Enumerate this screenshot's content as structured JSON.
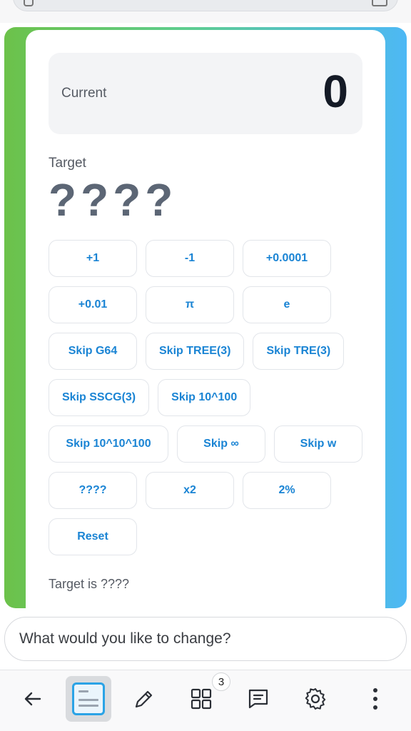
{
  "current": {
    "label": "Current",
    "value": "0"
  },
  "target": {
    "label": "Target",
    "value": "????"
  },
  "buttons": {
    "row1": [
      "+1",
      "-1",
      "+0.0001"
    ],
    "row2": [
      "+0.01",
      "π",
      "e"
    ],
    "row3": [
      "Skip G64",
      "Skip TREE(3)",
      "Skip TRE(3)"
    ],
    "row4": [
      "Skip SSCG(3)",
      "Skip 10^100"
    ],
    "row5": [
      "Skip 10^10^100",
      "Skip ∞",
      "Skip w"
    ],
    "row6": [
      "????",
      "x2",
      "2%"
    ],
    "row7": [
      "Reset"
    ]
  },
  "status": "Target is ????",
  "chat": {
    "placeholder": "What would you like to change?"
  },
  "toolbar": {
    "items": [
      "back-icon",
      "page-thumbnail",
      "pencil-icon",
      "grid-icon",
      "chat-icon",
      "gear-icon",
      "more-vertical-icon"
    ],
    "badge": "3"
  },
  "colors": {
    "accent": "#1a84d4",
    "gradient_start": "#6cc24a",
    "gradient_end": "#4db8f5",
    "thumbnail_border": "#2aa3e6"
  }
}
